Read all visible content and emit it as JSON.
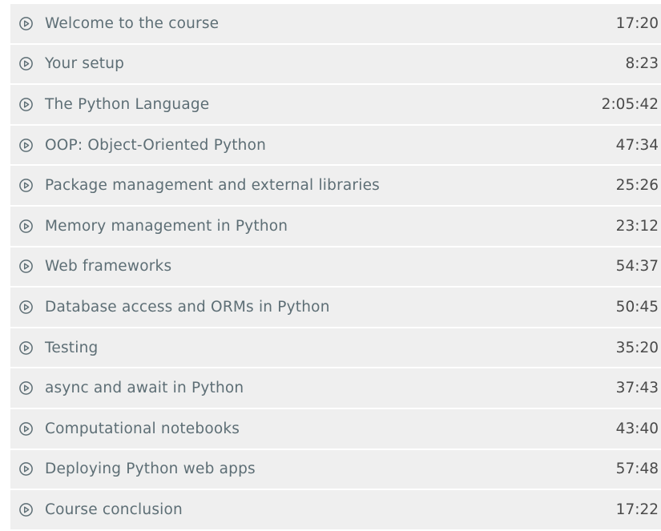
{
  "chapters": [
    {
      "title": "Welcome to the course",
      "duration": "17:20",
      "icon": "play-circle-icon"
    },
    {
      "title": "Your setup",
      "duration": "8:23",
      "icon": "play-circle-icon"
    },
    {
      "title": "The Python Language",
      "duration": "2:05:42",
      "icon": "play-circle-icon"
    },
    {
      "title": "OOP: Object-Oriented Python",
      "duration": "47:34",
      "icon": "play-circle-icon"
    },
    {
      "title": "Package management and external libraries",
      "duration": "25:26",
      "icon": "play-circle-icon"
    },
    {
      "title": "Memory management in Python",
      "duration": "23:12",
      "icon": "play-circle-icon"
    },
    {
      "title": "Web frameworks",
      "duration": "54:37",
      "icon": "play-circle-icon"
    },
    {
      "title": "Database access and ORMs in Python",
      "duration": "50:45",
      "icon": "play-circle-icon"
    },
    {
      "title": "Testing",
      "duration": "35:20",
      "icon": "play-circle-icon"
    },
    {
      "title": "async and await in Python",
      "duration": "37:43",
      "icon": "play-circle-icon"
    },
    {
      "title": "Computational notebooks",
      "duration": "43:40",
      "icon": "play-circle-icon"
    },
    {
      "title": "Deploying Python web apps",
      "duration": "57:48",
      "icon": "play-circle-icon"
    },
    {
      "title": "Course conclusion",
      "duration": "17:22",
      "icon": "play-circle-icon"
    }
  ],
  "colors": {
    "row_background": "#efefef",
    "title_text": "#5d6e75",
    "duration_text": "#4a4a4a",
    "icon_stroke": "#5d6e75"
  }
}
